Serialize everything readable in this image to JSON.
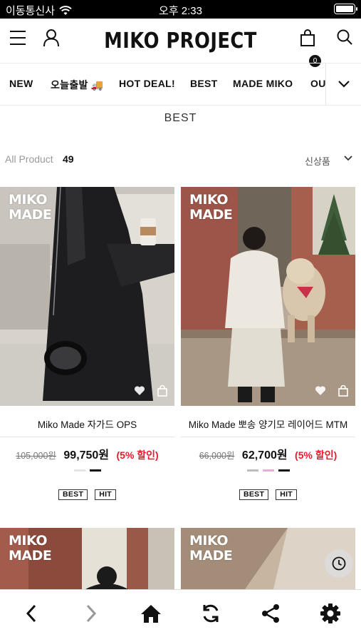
{
  "status_bar": {
    "carrier": "이동통신사",
    "time": "오후 2:33"
  },
  "header": {
    "logo": "MIKO PROJECT",
    "cart_count": "0"
  },
  "category_nav": {
    "items": [
      "NEW",
      "오늘출발 🚚",
      "HOT DEAL!",
      "BEST",
      "MADE MIKO",
      "OUTER"
    ]
  },
  "section_title": "BEST",
  "list_info": {
    "label": "All Product",
    "count": "49",
    "sort": "신상품"
  },
  "products": [
    {
      "badge": [
        "MIKO",
        "MADE"
      ],
      "name": "Miko Made 자가드 OPS",
      "original_price": "105,000원",
      "sale_price": "99,750원",
      "discount": "(5% 할인)",
      "swatches": [
        "#e4e4e4",
        "#111111"
      ],
      "tags": [
        "BEST",
        "HIT"
      ]
    },
    {
      "badge": [
        "MIKO",
        "MADE"
      ],
      "name": "Miko Made 뽀송 양기모 레이어드 MTM",
      "original_price": "66,000원",
      "sale_price": "62,700원",
      "discount": "(5% 할인)",
      "swatches": [
        "#bdbdbd",
        "#e3b0d6",
        "#111111"
      ],
      "tags": [
        "BEST",
        "HIT"
      ]
    },
    {
      "badge": [
        "MIKO",
        "MADE"
      ]
    },
    {
      "badge": [
        "MIKO",
        "MADE"
      ]
    }
  ],
  "colors": {
    "discount": "#e8192c",
    "accent": "#111111"
  },
  "toolbar_icons": [
    "back-icon",
    "forward-icon",
    "home-icon",
    "refresh-icon",
    "share-icon",
    "settings-icon"
  ]
}
